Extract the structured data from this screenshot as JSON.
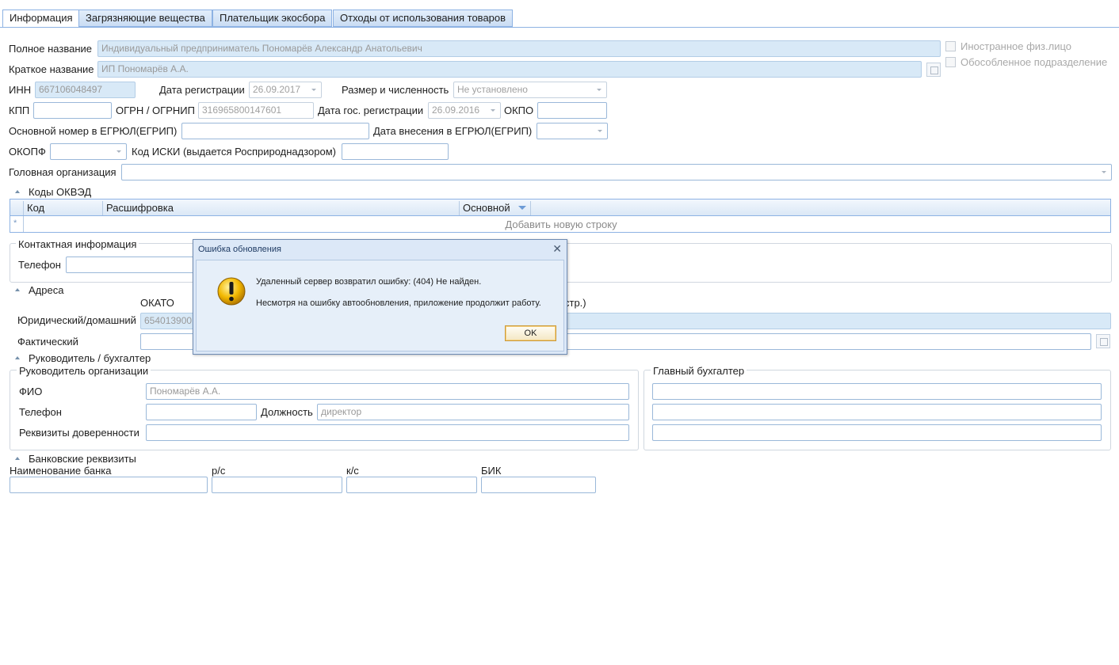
{
  "tabs": [
    "Информация",
    "Загрязняющие вещества",
    "Плательщик экосбора",
    "Отходы от использования товаров"
  ],
  "general": {
    "full_name_label": "Полное название",
    "full_name_value": "Индивидуальный предприниматель Пономарёв Александр Анатольевич",
    "short_name_label": "Краткое название",
    "short_name_value": "ИП Пономарёв А.А.",
    "foreign_person_label": "Иностранное физ.лицо",
    "separate_unit_label": "Обособленное подразделение",
    "inn_label": "ИНН",
    "inn_value": "667106048497",
    "reg_date_label": "Дата регистрации",
    "reg_date_value": "26.09.2017",
    "size_label": "Размер и численность",
    "size_value": "Не установлено",
    "kpp_label": "КПП",
    "kpp_value": "",
    "ogrn_label": "ОГРН / ОГРНИП",
    "ogrn_value": "316965800147601",
    "state_reg_date_label": "Дата гос. регистрации",
    "state_reg_date_value": "26.09.2016",
    "okpo_label": "ОКПО",
    "egrul_no_label": "Основной номер в ЕГРЮЛ(ЕГРИП)",
    "egrul_date_label": "Дата внесения в ЕГРЮЛ(ЕГРИП)",
    "okopf_label": "ОКОПФ",
    "iski_label": "Код ИСКИ (выдается Росприроднадзором)",
    "head_org_label": "Головная организация"
  },
  "okved": {
    "title": "Коды ОКВЭД",
    "columns": [
      "Код",
      "Расшифровка",
      "Основной"
    ],
    "new_row_marker": "*",
    "add_row_text": "Добавить новую строку"
  },
  "contact": {
    "title": "Контактная информация",
    "phone_label": "Телефон"
  },
  "addresses": {
    "title": "Адреса",
    "okato_header": "ОКАТО",
    "partial_header": "стр.)",
    "legal_label": "Юридический/домашний",
    "legal_okato_value": "654013900",
    "actual_label": "Фактический"
  },
  "managers": {
    "title": "Руководитель / бухгалтер",
    "head_group": "Руководитель организации",
    "fio_label": "ФИО",
    "fio_value": "Пономарёв А.А.",
    "phone_label": "Телефон",
    "position_label": "Должность",
    "position_value": "директор",
    "proxy_label": "Реквизиты доверенности",
    "accountant_group": "Главный бухгалтер"
  },
  "bank": {
    "title": "Банковские реквизиты",
    "bank_name_label": "Наименование банка",
    "rs_label": "р/с",
    "ks_label": "к/с",
    "bik_label": "БИК"
  },
  "dialog": {
    "title": "Ошибка обновления",
    "close_glyph": "✕",
    "message_1": "Удаленный сервер возвратил ошибку: (404) Не найден.",
    "message_2": "Несмотря на ошибку автообновления, приложение продолжит работу.",
    "ok_label": "OK",
    "icon": "warning-icon"
  },
  "colors": {
    "accent_border": "#8db2e3",
    "readonly_fill": "#d8e9f7",
    "warning": "#f2b800"
  }
}
